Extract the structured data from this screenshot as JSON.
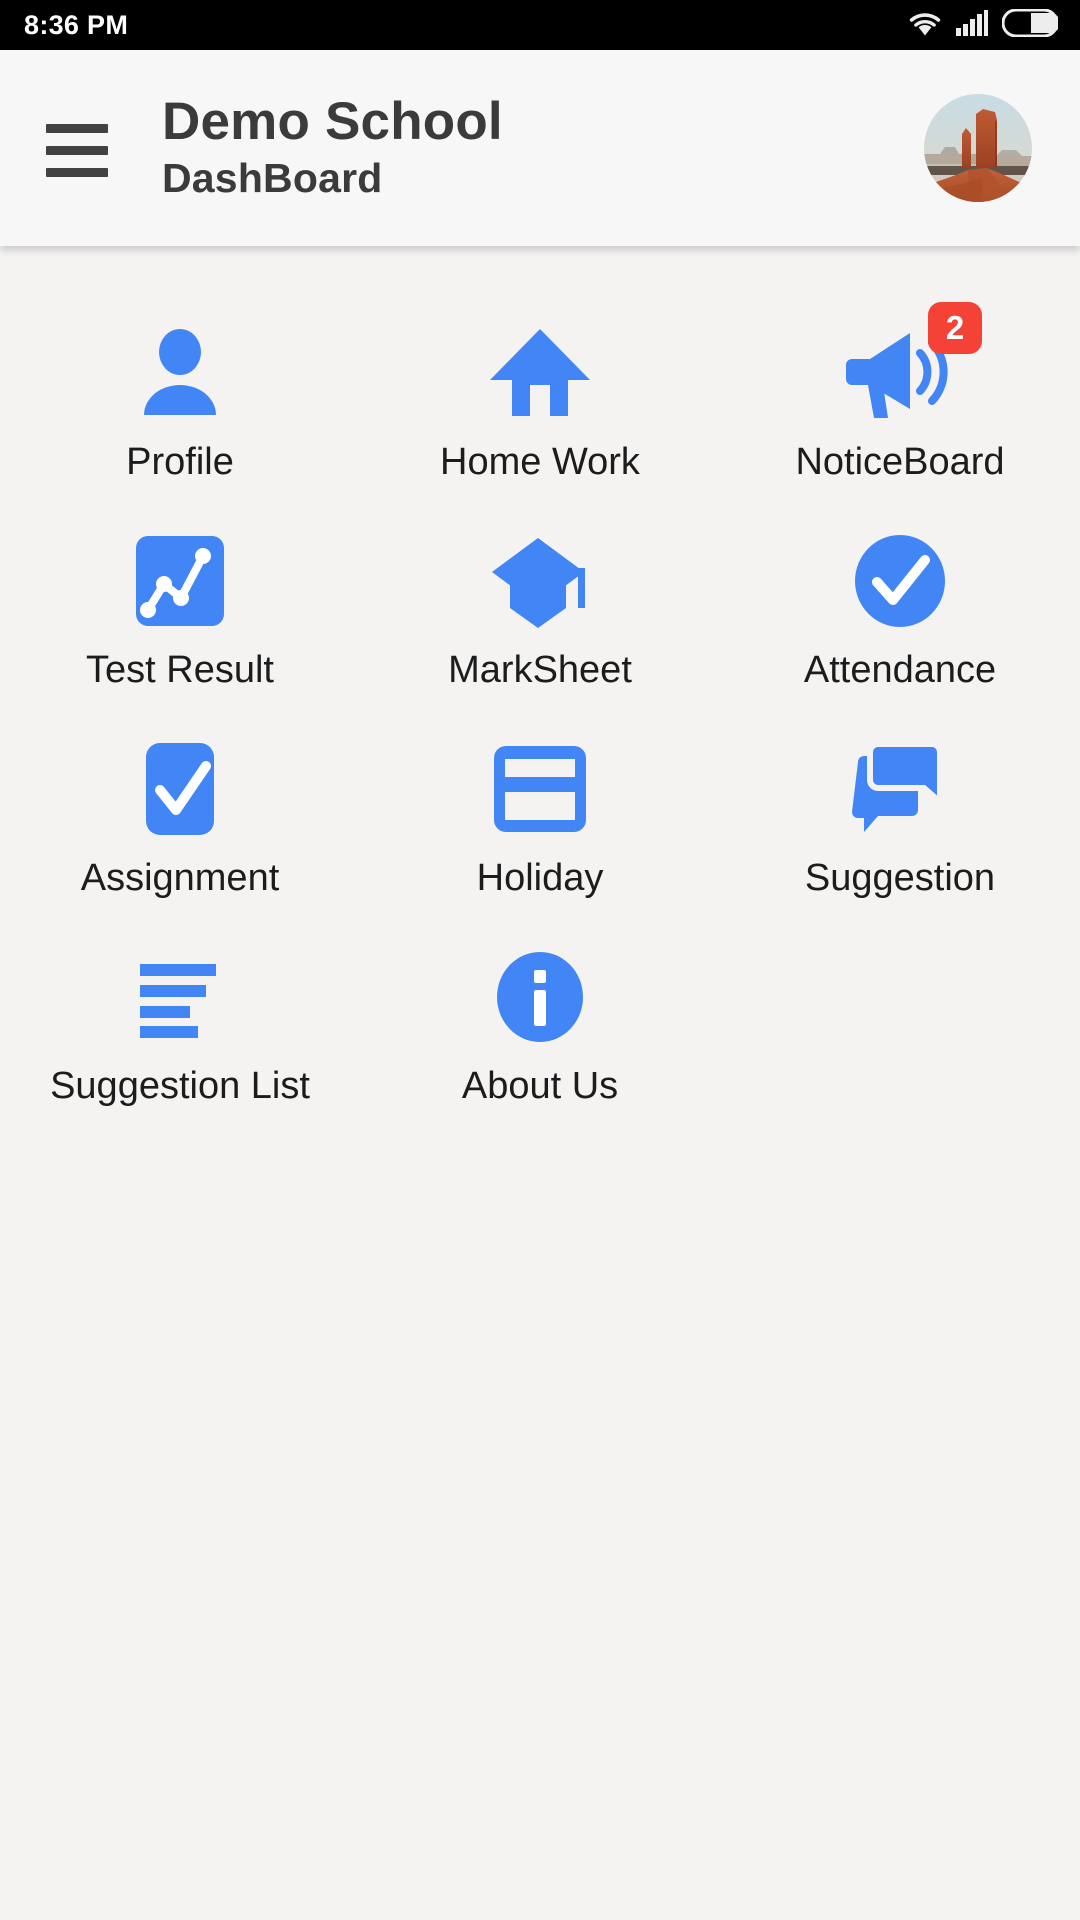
{
  "status_bar": {
    "time": "8:36 PM",
    "icons": [
      "wifi-icon",
      "cellular-signal-icon",
      "battery-icon"
    ],
    "background": "#000000",
    "foreground": "#FFFFFF"
  },
  "header": {
    "menu_icon": "hamburger-menu-icon",
    "title": "Demo School",
    "subtitle": "DashBoard",
    "avatar_icon": "user-avatar-desert-mesa-photo",
    "background": "#F7F7F7",
    "text_color": "#3B3B3B"
  },
  "theme": {
    "accent": "#4285F4",
    "badge": "#F44336",
    "page_background": "#F4F3F1",
    "label_color": "#1C1C1C"
  },
  "dashboard": {
    "columns": 3,
    "tiles": [
      {
        "label": "Profile",
        "icon": "person-icon"
      },
      {
        "label": "Home Work",
        "icon": "home-icon"
      },
      {
        "label": "NoticeBoard",
        "icon": "megaphone-icon",
        "badge": "2"
      },
      {
        "label": "Test Result",
        "icon": "chart-trend-icon"
      },
      {
        "label": "MarkSheet",
        "icon": "graduation-cap-icon"
      },
      {
        "label": "Attendance",
        "icon": "check-circle-icon"
      },
      {
        "label": "Assignment",
        "icon": "check-square-icon"
      },
      {
        "label": "Holiday",
        "icon": "credit-card-icon"
      },
      {
        "label": "Suggestion",
        "icon": "chat-bubbles-icon"
      },
      {
        "label": "Suggestion List",
        "icon": "sort-list-icon"
      },
      {
        "label": "About Us",
        "icon": "info-circle-icon"
      }
    ]
  }
}
